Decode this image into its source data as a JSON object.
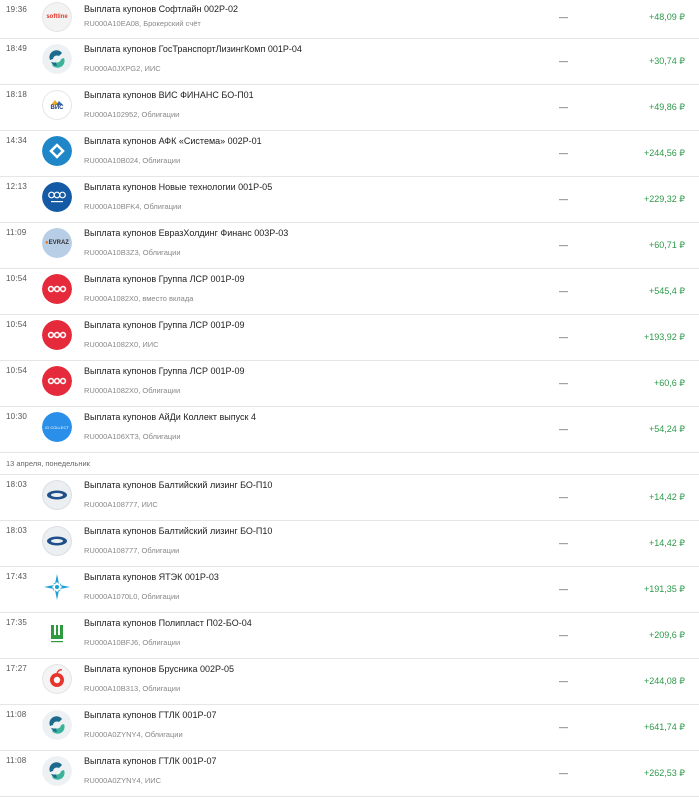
{
  "currency": "₽",
  "dash": "—",
  "groups": [
    {
      "header": "",
      "items": [
        {
          "time": "19:36",
          "title": "Выплата купонов Софтлайн 002P-02",
          "sub": "RU000A10EA08, Брокерский счёт",
          "amount": "+48,09 ₽",
          "logo": "softline-logo",
          "logo_text": "softline"
        },
        {
          "time": "18:49",
          "title": "Выплата купонов ГосТранспортЛизингКомп 001P-04",
          "sub": "RU000A0JXPG2, ИИС",
          "amount": "+30,74 ₽",
          "logo": "gtlk-logo"
        },
        {
          "time": "18:18",
          "title": "Выплата купонов ВИС ФИНАНС БО-П01",
          "sub": "RU000A102952, Облигации",
          "amount": "+49,86 ₽",
          "logo": "vis-logo",
          "logo_text": "ВИС"
        },
        {
          "time": "14:34",
          "title": "Выплата купонов АФК «Система» 002P-01",
          "sub": "RU000A10B024, Облигации",
          "amount": "+244,56 ₽",
          "logo": "sistema-logo"
        },
        {
          "time": "12:13",
          "title": "Выплата купонов Новые технологии 001P-05",
          "sub": "RU000A10BFK4, Облигации",
          "amount": "+229,32 ₽",
          "logo": "novye-tekhnologii-logo"
        },
        {
          "time": "11:09",
          "title": "Выплата купонов ЕвразХолдинг Финанс 003P-03",
          "sub": "RU000A10B3Z3, Облигации",
          "amount": "+60,71 ₽",
          "logo": "evraz-logo",
          "logo_text": "EVRAZ"
        },
        {
          "time": "10:54",
          "title": "Выплата купонов Группа ЛСР 001P-09",
          "sub": "RU000A1082X0, вместо вклада",
          "amount": "+545,4 ₽",
          "logo": "lsr-logo"
        },
        {
          "time": "10:54",
          "title": "Выплата купонов Группа ЛСР 001P-09",
          "sub": "RU000A1082X0, ИИС",
          "amount": "+193,92 ₽",
          "logo": "lsr-logo"
        },
        {
          "time": "10:54",
          "title": "Выплата купонов Группа ЛСР 001P-09",
          "sub": "RU000A1082X0, Облигации",
          "amount": "+60,6 ₽",
          "logo": "lsr-logo"
        },
        {
          "time": "10:30",
          "title": "Выплата купонов АйДи Коллект выпуск 4",
          "sub": "RU000A106XT3, Облигации",
          "amount": "+54,24 ₽",
          "logo": "id-collect-logo",
          "logo_text": "ID COLLECT"
        }
      ]
    },
    {
      "header": "13 апреля, понедельник",
      "items": [
        {
          "time": "18:03",
          "title": "Выплата купонов Балтийский лизинг БО-П10",
          "sub": "RU000A108777, ИИС",
          "amount": "+14,42 ₽",
          "logo": "baltic-leasing-logo"
        },
        {
          "time": "18:03",
          "title": "Выплата купонов Балтийский лизинг БО-П10",
          "sub": "RU000A108777, Облигации",
          "amount": "+14,42 ₽",
          "logo": "baltic-leasing-logo"
        },
        {
          "time": "17:43",
          "title": "Выплата купонов ЯТЭК 001P-03",
          "sub": "RU000A1070L0, Облигации",
          "amount": "+191,35 ₽",
          "logo": "yatek-logo"
        },
        {
          "time": "17:35",
          "title": "Выплата купонов Полипласт П02-БО-04",
          "sub": "RU000A10BFJ6, Облигации",
          "amount": "+209,6 ₽",
          "logo": "poliplast-logo"
        },
        {
          "time": "17:27",
          "title": "Выплата купонов Брусника 002P-05",
          "sub": "RU000A10B313, Облигации",
          "amount": "+244,08 ₽",
          "logo": "brusnika-logo"
        },
        {
          "time": "11:08",
          "title": "Выплата купонов ГТЛК 001P-07",
          "sub": "RU000A0ZYNY4, Облигации",
          "amount": "+641,74 ₽",
          "logo": "gtlk-logo"
        },
        {
          "time": "11:08",
          "title": "Выплата купонов ГТЛК 001P-07",
          "sub": "RU000A0ZYNY4, ИИС",
          "amount": "+262,53 ₽",
          "logo": "gtlk-logo"
        }
      ]
    }
  ]
}
